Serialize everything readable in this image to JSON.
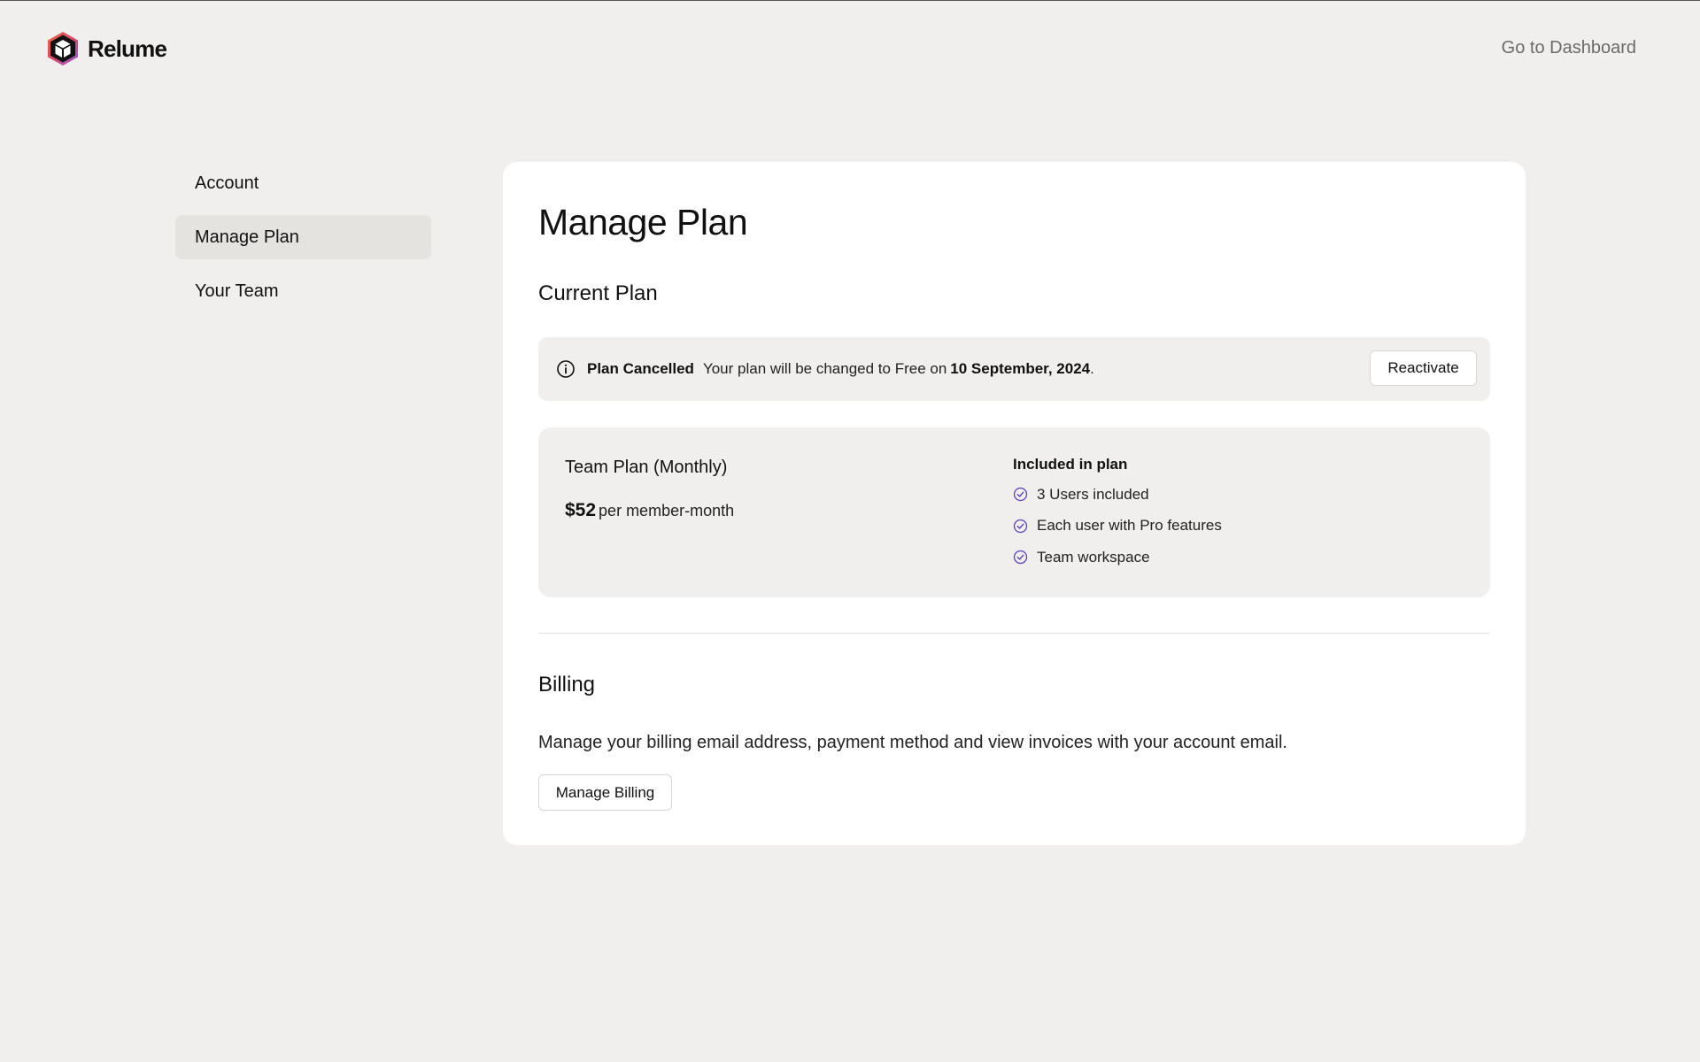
{
  "header": {
    "brand": "Relume",
    "dashboard_link": "Go to Dashboard"
  },
  "sidebar": {
    "items": [
      {
        "label": "Account",
        "active": false
      },
      {
        "label": "Manage Plan",
        "active": true
      },
      {
        "label": "Your Team",
        "active": false
      }
    ]
  },
  "main": {
    "title": "Manage Plan",
    "current_plan": {
      "heading": "Current Plan",
      "notice": {
        "icon": "info-icon",
        "status": "Plan Cancelled",
        "message": "Your plan will be changed to Free on",
        "date": "10 September, 2024",
        "punctuation": ".",
        "button": "Reactivate"
      },
      "plan": {
        "name": "Team Plan (Monthly)",
        "price": "$52",
        "price_unit": "per member-month",
        "included_title": "Included in plan",
        "features": [
          "3 Users included",
          "Each user with Pro features",
          "Team workspace"
        ]
      }
    },
    "billing": {
      "heading": "Billing",
      "description": "Manage your billing email address, payment method and view invoices with your account email.",
      "button": "Manage Billing"
    }
  },
  "colors": {
    "background": "#f0efed",
    "card": "#ffffff",
    "active_nav": "#e4e3e0",
    "check_accent": "#5b3fc4"
  }
}
